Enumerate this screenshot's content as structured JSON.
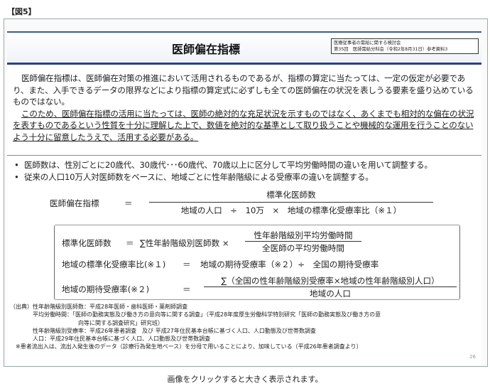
{
  "figure_label": "【図5】",
  "slide": {
    "title": "医師偏在指標",
    "ref_line1": "医療従事者の需給に関する検討会",
    "ref_line2": "第35回　医師需給分科会（令和2年8月31日）参考資料3",
    "intro_p1": "医師偏在指標は、医師偏在対策の推進において活用されるものであるが、指標の算定に当たっては、一定の仮定が必要であり、また、入手できるデータの限界などにより指標の算定式に必ずしも全ての医師偏在の状況を表しうる要素を盛り込めているものではない。",
    "intro_p2": "このため、医師偏在指標の活用に当たっては、医師の絶対的な充足状況を示すものではなく、あくまでも相対的な偏在の状況を表すものであるという性質を十分に理解した上で、数値を絶対的な基準として取り扱うことや機械的な運用を行うことのないよう十分に留意したうえで、活用する必要がある。",
    "bullets": [
      "医師数は、性別ごとに20歳代、30歳代･･･60歳代、70歳以上に区分して平均労働時間の違いを用いて調整する。",
      "従来の人口10万人対医師数をベースに、地域ごとに性年齢階級による受療率の違いを調整する。"
    ],
    "formula_main": {
      "lhs": "医師偏在指標",
      "eq": "＝",
      "numerator": "標準化医師数",
      "denominator": "地域の人口　÷　10万　×　地域の標準化受療率比（※１）"
    },
    "formula_box": {
      "r1_lhs": "標準化医師数",
      "r1_eq": "＝",
      "r1_mid": "∑性年齢階級別医師数 ×",
      "r1_num": "性年齢階級別平均労働時間",
      "r1_den": "全医師の平均労働時間",
      "r2_lhs": "地域の標準化受療率比(※１)",
      "r2_eq": "＝",
      "r2_rhs": "地域の期待受療率（※２）÷　全国の期待受療率",
      "r3_lhs": "地域の期待受療率(※２)",
      "r3_eq": "＝",
      "r3_num": "∑（全国の性年齢階級別受療率×地域の性年齢階級別人口）",
      "r3_den": "地域の人口"
    },
    "notes": [
      "（出典）性年齢階級別医師数：平成28年医師・歯科医師・薬剤師調査",
      "　　　　平均労働時間：「医師の勤務実態及び働き方の意向等に関する調査」（平成28年度厚生労働科学特別研究「医師の勤務実態及び働き方の意",
      "　　　　　　　　　　　　向等に関する調査研究」研究班）",
      "　　　　性年齢階級別受療率：平成26年患者調査　及び 平成27年住民基本台帳に基づく人口、人口動態及び世帯数調査",
      "　　　　人口：平成29年住民基本台帳に基づく人口、人口動態及び世帯数調査",
      "　※患者流出入は、流出入発生後のデータ（診療行為発生地ベース）を分母で用いることにより、加味している（平成26年患者調査より）"
    ],
    "page_number": "26"
  },
  "caption": "画像をクリックすると大きく表示されます。"
}
